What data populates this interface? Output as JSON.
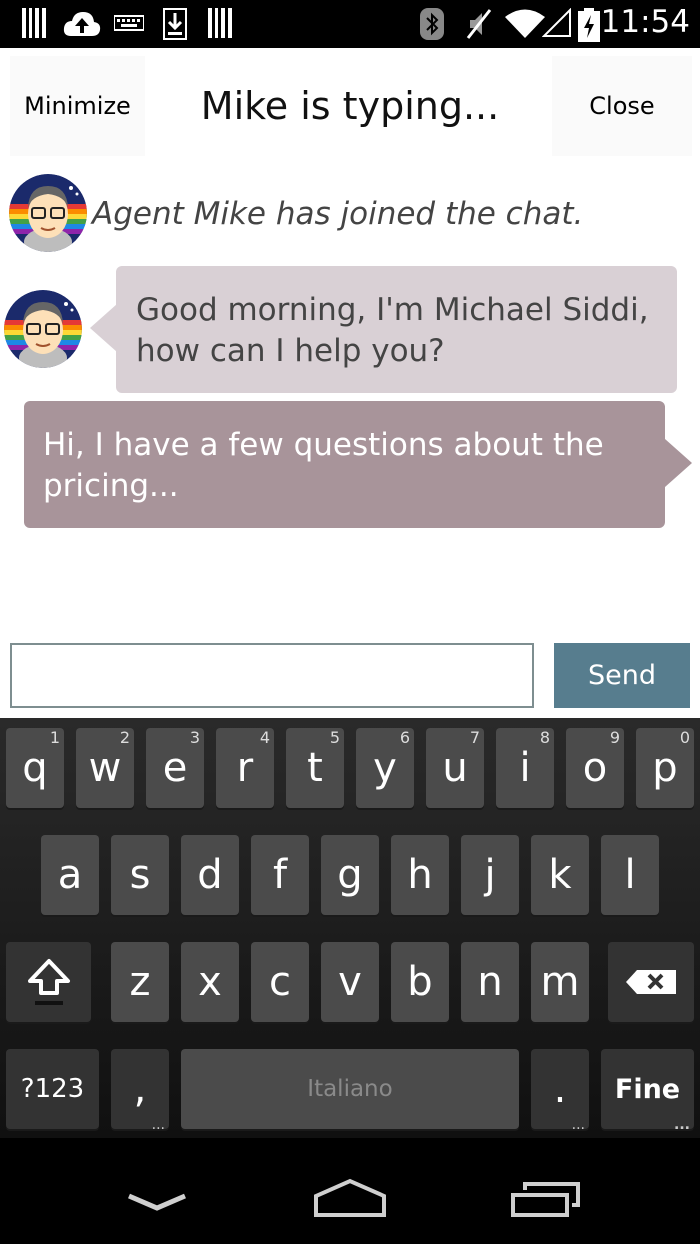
{
  "status_bar": {
    "time": "11:54",
    "icons": [
      "barcode-icon",
      "cloud-upload-icon",
      "keyboard-icon",
      "download-icon",
      "barcode-icon",
      "bluetooth-icon",
      "mute-icon",
      "wifi-icon",
      "signal-icon",
      "battery-charging-icon"
    ]
  },
  "header": {
    "minimize_label": "Minimize",
    "title": "Mike is typing...",
    "close_label": "Close"
  },
  "chat": {
    "system_message": "Agent Mike has joined the chat.",
    "agent_message_line1": "Good morning, I'm Michael Siddi,",
    "agent_message_line2": "how can I help you?",
    "user_message_line1": "Hi, I have a few questions about the",
    "user_message_line2": "pricing..."
  },
  "composer": {
    "input_value": "",
    "send_label": "Send"
  },
  "keyboard": {
    "row1": [
      {
        "key": "q",
        "hint": "1"
      },
      {
        "key": "w",
        "hint": "2"
      },
      {
        "key": "e",
        "hint": "3"
      },
      {
        "key": "r",
        "hint": "4"
      },
      {
        "key": "t",
        "hint": "5"
      },
      {
        "key": "y",
        "hint": "6"
      },
      {
        "key": "u",
        "hint": "7"
      },
      {
        "key": "i",
        "hint": "8"
      },
      {
        "key": "o",
        "hint": "9"
      },
      {
        "key": "p",
        "hint": "0"
      }
    ],
    "row2": [
      "a",
      "s",
      "d",
      "f",
      "g",
      "h",
      "j",
      "k",
      "l"
    ],
    "row3": [
      "z",
      "x",
      "c",
      "v",
      "b",
      "n",
      "m"
    ],
    "symbols_label": "?123",
    "comma_label": ",",
    "space_label": "Italiano",
    "period_label": ".",
    "enter_label": "Fine"
  },
  "colors": {
    "agent_bubble": "#d9d0d5",
    "user_bubble": "#a8949a",
    "send_button": "#577d8e"
  }
}
